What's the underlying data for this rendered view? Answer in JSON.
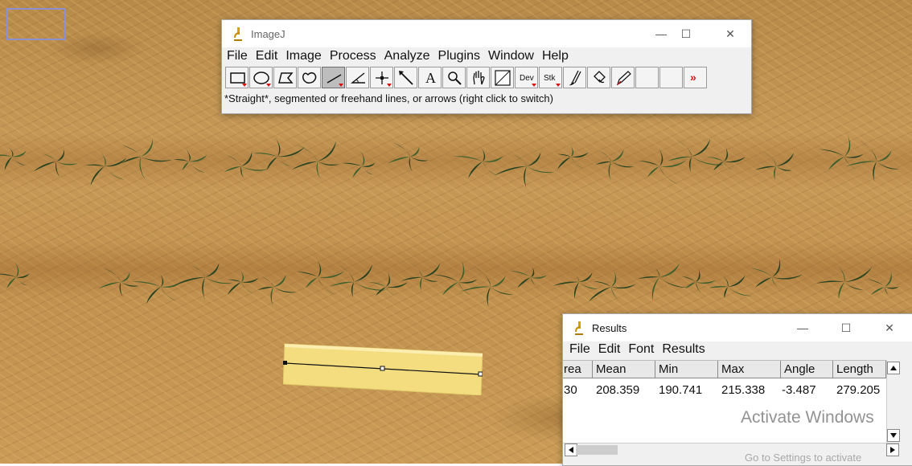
{
  "imagej": {
    "title": "ImageJ",
    "menu": [
      "File",
      "Edit",
      "Image",
      "Process",
      "Analyze",
      "Plugins",
      "Window",
      "Help"
    ],
    "tools": [
      {
        "name": "rectangle-tool-icon",
        "glyph": "rect",
        "menu": true
      },
      {
        "name": "oval-tool-icon",
        "glyph": "oval",
        "menu": true
      },
      {
        "name": "polygon-tool-icon",
        "glyph": "poly",
        "menu": false
      },
      {
        "name": "freehand-tool-icon",
        "glyph": "free",
        "menu": false
      },
      {
        "name": "line-tool-icon",
        "glyph": "line",
        "menu": true,
        "active": true
      },
      {
        "name": "angle-tool-icon",
        "glyph": "angle",
        "menu": false
      },
      {
        "name": "point-tool-icon",
        "glyph": "point",
        "menu": true
      },
      {
        "name": "wand-tool-icon",
        "glyph": "wand",
        "menu": false
      },
      {
        "name": "text-tool-icon",
        "glyph": "text",
        "label": "A",
        "menu": false
      },
      {
        "name": "magnifier-tool-icon",
        "glyph": "zoom",
        "menu": false
      },
      {
        "name": "hand-tool-icon",
        "glyph": "hand",
        "menu": false
      },
      {
        "name": "color-picker-tool-icon",
        "glyph": "picker",
        "menu": false
      },
      {
        "name": "developer-menu-icon",
        "glyph": "dev",
        "label": "Dev",
        "menu": true
      },
      {
        "name": "stacks-menu-icon",
        "glyph": "stk",
        "label": "Stk",
        "menu": true
      },
      {
        "name": "brush-tool-icon",
        "glyph": "brush",
        "menu": false
      },
      {
        "name": "flood-fill-tool-icon",
        "glyph": "fill",
        "menu": false
      },
      {
        "name": "pencil-tool-icon",
        "glyph": "pencil",
        "menu": false
      },
      {
        "name": "empty-tool-slot",
        "glyph": "empty",
        "menu": false
      },
      {
        "name": "empty-tool-slot",
        "glyph": "empty",
        "menu": false
      },
      {
        "name": "more-tools-icon",
        "glyph": "more",
        "label": "»",
        "menu": false
      }
    ],
    "status": "*Straight*, segmented or freehand lines, or arrows (right click to switch)"
  },
  "results": {
    "title": "Results",
    "menu": [
      "File",
      "Edit",
      "Font",
      "Results"
    ],
    "columns": [
      "rea",
      "Mean",
      "Min",
      "Max",
      "Angle",
      "Length"
    ],
    "row": [
      "30",
      "208.359",
      "190.741",
      "215.338",
      "-3.487",
      "279.205"
    ]
  },
  "windows_watermark": {
    "title": "Activate Windows",
    "subtitle": "Go to Settings to activate"
  },
  "colors": {
    "ruler": "#f3dd7e",
    "selection": "#8c8fd0",
    "plant": "#2f4a22"
  }
}
